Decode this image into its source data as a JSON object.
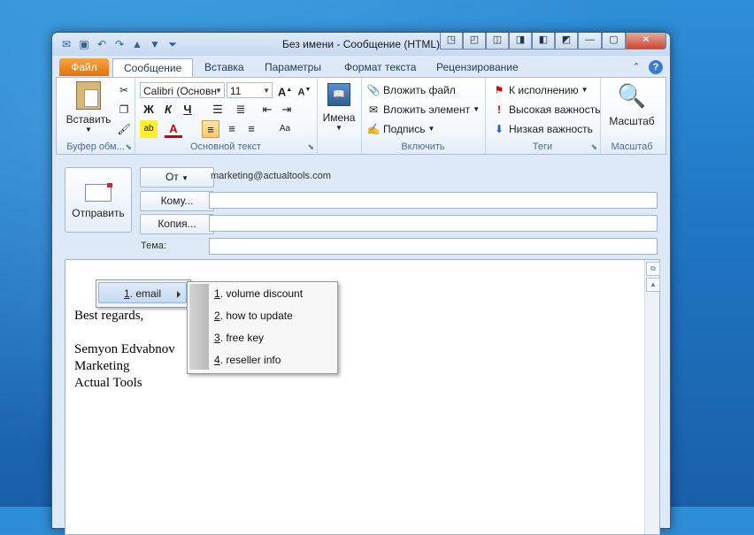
{
  "window": {
    "title": "Без имени - Сообщение (HTML)",
    "qat_icons": [
      "outlook-icon",
      "save-icon",
      "undo-icon",
      "redo-icon",
      "up-arrow-icon",
      "down-arrow-icon",
      "customize-icon"
    ],
    "controls": [
      "◳",
      "◰",
      "◫",
      "◨",
      "◧",
      "◩",
      "—",
      "▢",
      "✕"
    ]
  },
  "tabs": [
    {
      "label": "Файл"
    },
    {
      "label": "Сообщение"
    },
    {
      "label": "Вставка"
    },
    {
      "label": "Параметры"
    },
    {
      "label": "Формат текста"
    },
    {
      "label": "Рецензирование"
    }
  ],
  "ribbon": {
    "clipboard": {
      "label": "Буфер обм...",
      "paste": "Вставить"
    },
    "font": {
      "label": "Основной текст",
      "font_name": "Calibri (Основн",
      "font_size": "11",
      "bold": "Ж",
      "italic": "К",
      "underline": "Ч"
    },
    "names": {
      "label": "Имена"
    },
    "include": {
      "label": "Включить",
      "attach_file": "Вложить файл",
      "attach_item": "Вложить элемент",
      "signature": "Подпись"
    },
    "tags": {
      "label": "Теги",
      "follow_up": "К исполнению",
      "high": "Высокая важность",
      "low": "Низкая важность"
    },
    "zoom": {
      "label": "Масштаб",
      "button": "Масштаб"
    }
  },
  "compose": {
    "send": "Отправить",
    "from_btn": "От",
    "from_value": "marketing@actualtools.com",
    "to_btn": "Кому...",
    "cc_btn": "Копия...",
    "subject_label": "Тема:"
  },
  "body": {
    "lines": [
      "Best regards,",
      "",
      "Semyon Edvabnov",
      "Marketing",
      "Actual Tools"
    ]
  },
  "menu": {
    "item": {
      "num": "1",
      "label": ". email"
    },
    "submenu": [
      {
        "num": "1",
        "label": ". volume discount"
      },
      {
        "num": "2",
        "label": ". how to update"
      },
      {
        "num": "3",
        "label": ". free key"
      },
      {
        "num": "4",
        "label": ". reseller info"
      }
    ]
  },
  "colors": {
    "file_tab": "#e2730f",
    "accent": "#1e395b",
    "desktop": "#1f76c2"
  }
}
